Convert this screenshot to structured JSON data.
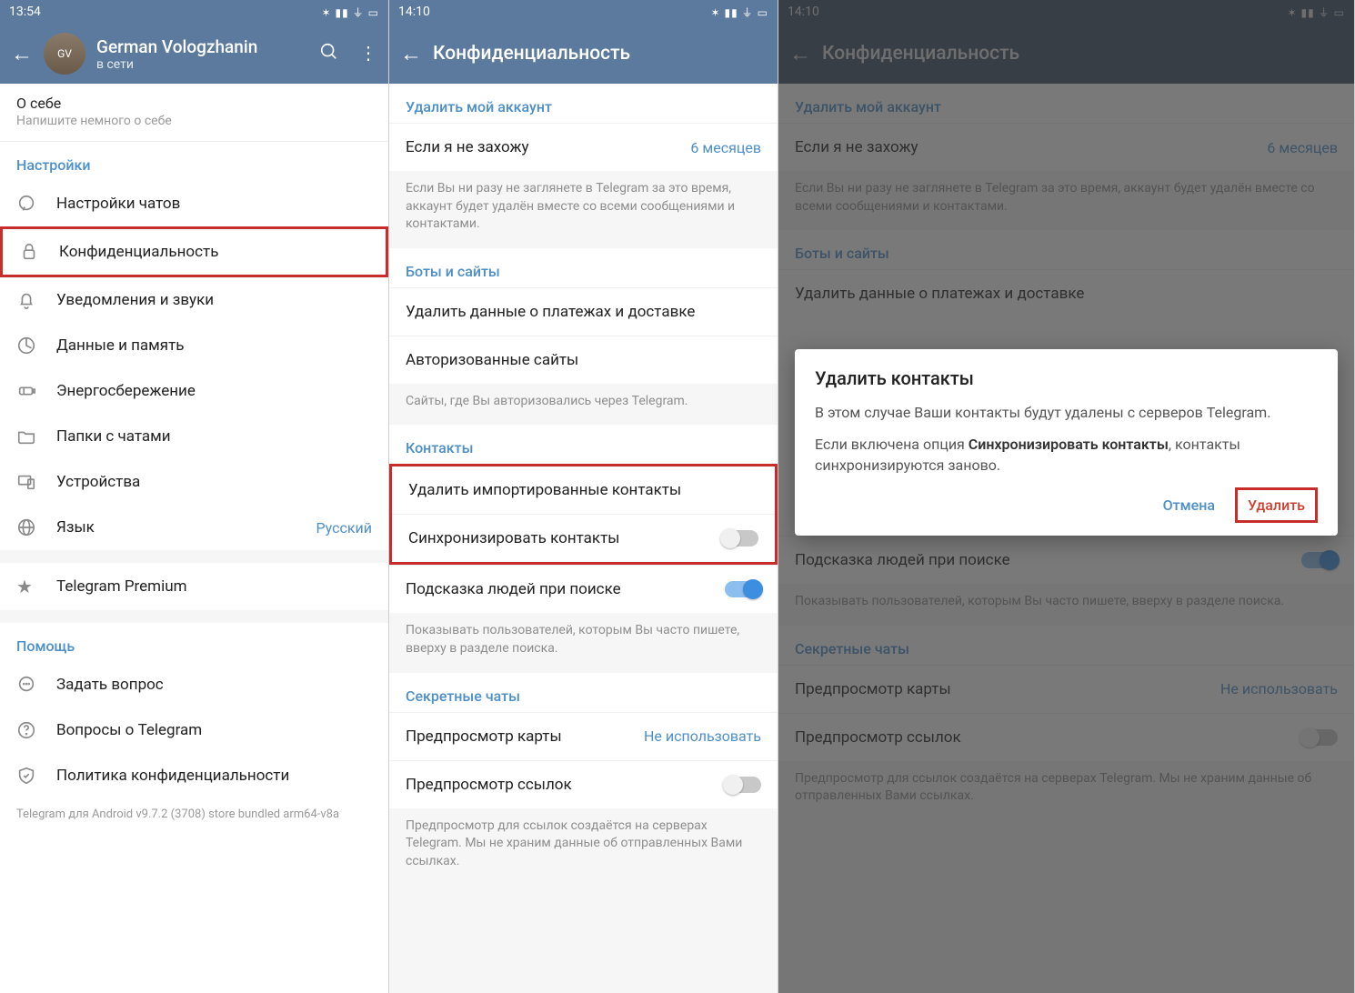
{
  "pane1": {
    "time": "13:54",
    "user_name": "German Vologzhanin",
    "user_status": "в сети",
    "about_label": "О себе",
    "about_hint": "Напишите немного о себе",
    "settings_header": "Настройки",
    "items": {
      "chats": "Настройки чатов",
      "privacy": "Конфиденциальность",
      "notifications": "Уведомления и звуки",
      "data": "Данные и память",
      "power": "Энергосбережение",
      "folders": "Папки с чатами",
      "devices": "Устройства",
      "language": "Язык",
      "language_value": "Русский",
      "premium": "Telegram Premium"
    },
    "help_header": "Помощь",
    "help": {
      "ask": "Задать вопрос",
      "faq": "Вопросы о Telegram",
      "policy": "Политика конфиденциальности"
    },
    "version": "Telegram для Android v9.7.2 (3708) store bundled arm64-v8a"
  },
  "pane2": {
    "time": "14:10",
    "title": "Конфиденциальность",
    "delete_account_header": "Удалить мой аккаунт",
    "if_away": "Если я не захожу",
    "if_away_value": "6 месяцев",
    "if_away_desc": "Если Вы ни разу не заглянете в Telegram за это время, аккаунт будет удалён вместе со всеми сообщениями и контактами.",
    "bots_header": "Боты и сайты",
    "delete_pay": "Удалить данные о платежах и доставке",
    "auth_sites": "Авторизованные сайты",
    "auth_desc": "Сайты, где Вы авторизовались через Telegram.",
    "contacts_header": "Контакты",
    "delete_imported": "Удалить импортированные контакты",
    "sync_contacts": "Синхронизировать контакты",
    "suggest": "Подсказка людей при поиске",
    "suggest_desc": "Показывать пользователей, которым Вы часто пишете, вверху в разделе поиска.",
    "secret_header": "Секретные чаты",
    "map_preview": "Предпросмотр карты",
    "map_preview_value": "Не использовать",
    "link_preview": "Предпросмотр ссылок",
    "link_desc": "Предпросмотр для ссылок создаётся на серверах Telegram. Мы не храним данные об отправленных Вами ссылках."
  },
  "pane3": {
    "time": "14:10",
    "title": "Конфиденциальность",
    "dialog_title": "Удалить контакты",
    "dialog_p1": "В этом случае Ваши контакты будут удалены с серверов Telegram.",
    "dialog_p2a": "Если включена опция ",
    "dialog_p2b": "Синхронизировать контакты",
    "dialog_p2c": ", контакты синхронизируются заново.",
    "cancel": "Отмена",
    "delete": "Удалить"
  }
}
